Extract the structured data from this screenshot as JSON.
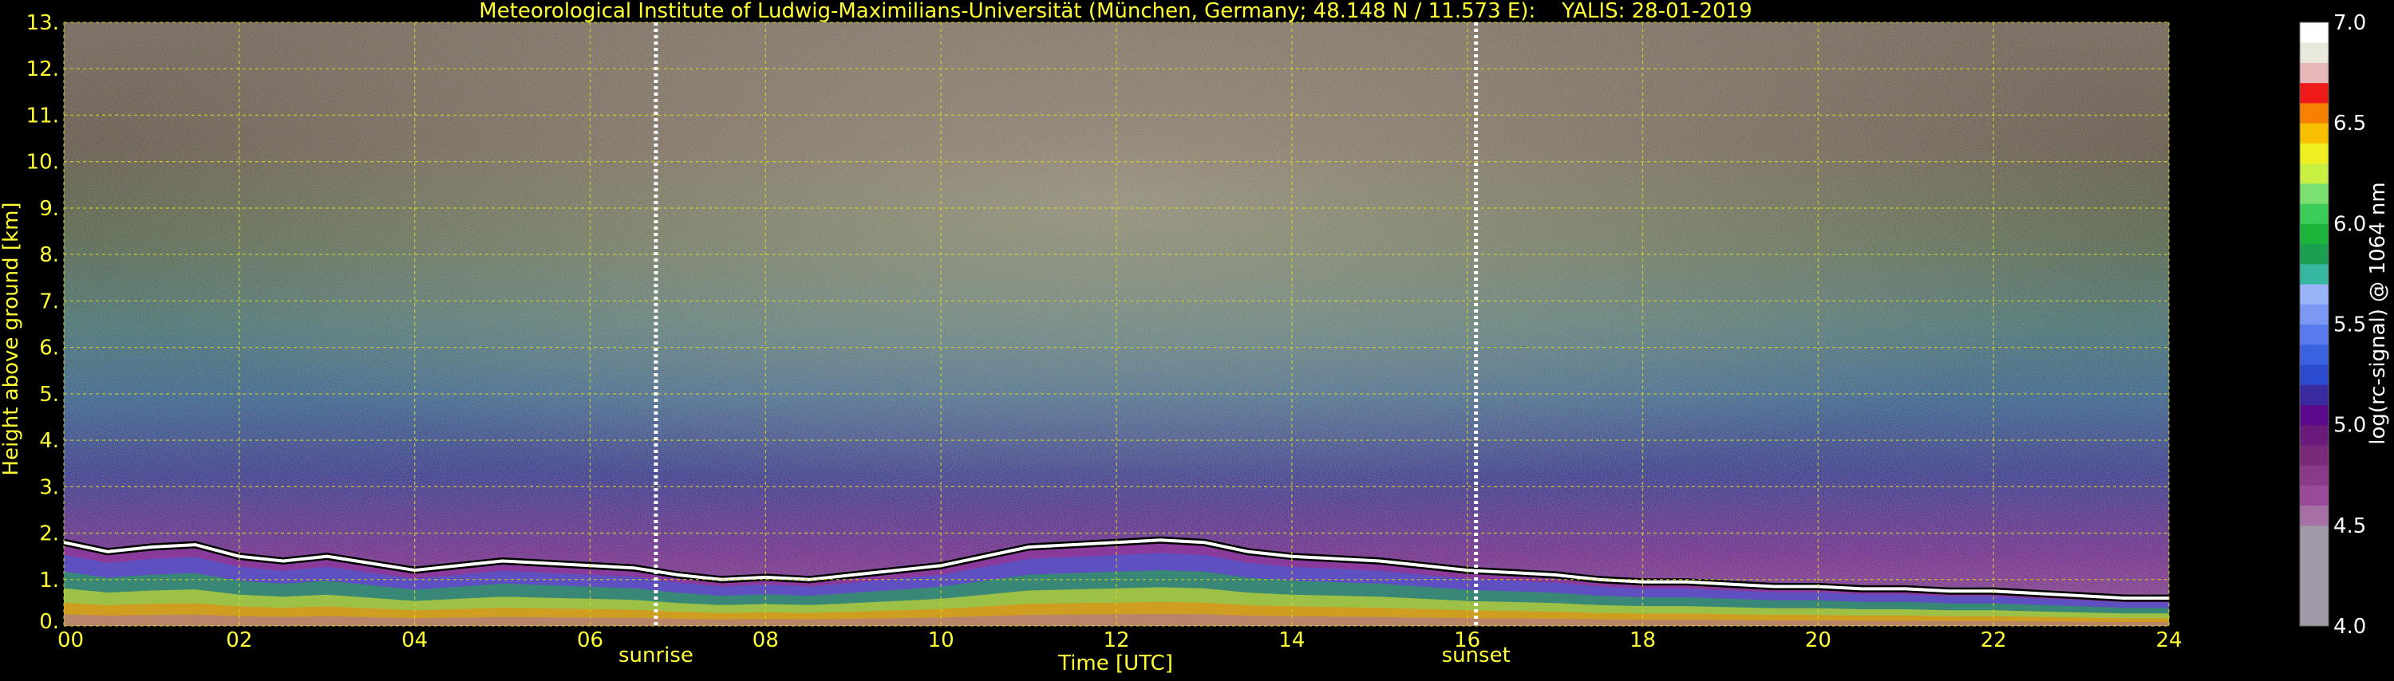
{
  "chart_data": {
    "type": "heatmap",
    "title": "Meteorological Institute of Ludwig-Maximilians-Universität (München, Germany; 48.148 N / 11.573 E):    YALIS: 28-01-2019",
    "xlabel": "Time [UTC]",
    "ylabel": "Height above ground [km]",
    "xlim": [
      0,
      24
    ],
    "ylim": [
      0,
      13
    ],
    "x_ticks": [
      0,
      2,
      4,
      6,
      8,
      10,
      12,
      14,
      16,
      18,
      20,
      22,
      24
    ],
    "x_tick_labels": [
      "00",
      "02",
      "04",
      "06",
      "08",
      "10",
      "12",
      "14",
      "16",
      "18",
      "20",
      "22",
      "24"
    ],
    "y_ticks": [
      0,
      1,
      2,
      3,
      4,
      5,
      6,
      7,
      8,
      9,
      10,
      11,
      12,
      13
    ],
    "y_tick_labels": [
      "0.",
      "1.",
      "2.",
      "3.",
      "4.",
      "5.",
      "6.",
      "7.",
      "8.",
      "9.",
      "10.",
      "11.",
      "12.",
      "13."
    ],
    "grid": true,
    "colorbar": {
      "label": "log(rc-signal) @ 1064 nm",
      "range": [
        4.0,
        7.0
      ],
      "ticks": [
        4.0,
        4.5,
        5.0,
        5.5,
        6.0,
        6.5,
        7.0
      ],
      "tick_labels": [
        "4.0",
        "4.5",
        "5.0",
        "5.5",
        "6.0",
        "6.5",
        "7.0"
      ],
      "levels": [
        {
          "from": 4.0,
          "to": 4.5,
          "color": "#a09aa8"
        },
        {
          "from": 4.5,
          "to": 4.6,
          "color": "#a571a5"
        },
        {
          "from": 4.6,
          "to": 4.7,
          "color": "#9a4a9a"
        },
        {
          "from": 4.7,
          "to": 4.8,
          "color": "#8b3a8b"
        },
        {
          "from": 4.8,
          "to": 4.9,
          "color": "#7a2a7a"
        },
        {
          "from": 4.9,
          "to": 5.0,
          "color": "#6a1a7a"
        },
        {
          "from": 5.0,
          "to": 5.1,
          "color": "#5a0a8a"
        },
        {
          "from": 5.1,
          "to": 5.2,
          "color": "#3a2aa0"
        },
        {
          "from": 5.2,
          "to": 5.3,
          "color": "#2a4ad0"
        },
        {
          "from": 5.3,
          "to": 5.4,
          "color": "#3a62e0"
        },
        {
          "from": 5.4,
          "to": 5.5,
          "color": "#5a7af0"
        },
        {
          "from": 5.5,
          "to": 5.6,
          "color": "#7a98f4"
        },
        {
          "from": 5.6,
          "to": 5.7,
          "color": "#9ab4f8"
        },
        {
          "from": 5.7,
          "to": 5.8,
          "color": "#36b8a0"
        },
        {
          "from": 5.8,
          "to": 5.9,
          "color": "#1aa050"
        },
        {
          "from": 5.9,
          "to": 6.0,
          "color": "#1cb43a"
        },
        {
          "from": 6.0,
          "to": 6.1,
          "color": "#3ccc5a"
        },
        {
          "from": 6.1,
          "to": 6.2,
          "color": "#7ae070"
        },
        {
          "from": 6.2,
          "to": 6.3,
          "color": "#c8f040"
        },
        {
          "from": 6.3,
          "to": 6.4,
          "color": "#f0f020"
        },
        {
          "from": 6.4,
          "to": 6.5,
          "color": "#f8c000"
        },
        {
          "from": 6.5,
          "to": 6.6,
          "color": "#f88000"
        },
        {
          "from": 6.6,
          "to": 6.7,
          "color": "#ee1a1a"
        },
        {
          "from": 6.7,
          "to": 6.8,
          "color": "#e8b8b8"
        },
        {
          "from": 6.8,
          "to": 6.9,
          "color": "#e8e8dc"
        },
        {
          "from": 6.9,
          "to": 7.0,
          "color": "#ffffff"
        }
      ]
    },
    "annotations": [
      {
        "label": "sunrise",
        "x": 6.75
      },
      {
        "label": "sunset",
        "x": 16.1
      }
    ],
    "cloud_top_line": [
      [
        0,
        1.8
      ],
      [
        0.5,
        1.6
      ],
      [
        1,
        1.7
      ],
      [
        1.5,
        1.75
      ],
      [
        2,
        1.5
      ],
      [
        2.5,
        1.4
      ],
      [
        3,
        1.5
      ],
      [
        3.5,
        1.35
      ],
      [
        4,
        1.2
      ],
      [
        4.5,
        1.3
      ],
      [
        5,
        1.4
      ],
      [
        5.5,
        1.35
      ],
      [
        6,
        1.3
      ],
      [
        6.5,
        1.25
      ],
      [
        7,
        1.1
      ],
      [
        7.5,
        1.0
      ],
      [
        8,
        1.05
      ],
      [
        8.5,
        1.0
      ],
      [
        9,
        1.1
      ],
      [
        9.5,
        1.2
      ],
      [
        10,
        1.3
      ],
      [
        10.5,
        1.5
      ],
      [
        11,
        1.7
      ],
      [
        11.5,
        1.75
      ],
      [
        12,
        1.8
      ],
      [
        12.5,
        1.85
      ],
      [
        13,
        1.8
      ],
      [
        13.5,
        1.6
      ],
      [
        14,
        1.5
      ],
      [
        14.5,
        1.45
      ],
      [
        15,
        1.4
      ],
      [
        15.5,
        1.3
      ],
      [
        16,
        1.2
      ],
      [
        16.5,
        1.15
      ],
      [
        17,
        1.1
      ],
      [
        17.5,
        1.0
      ],
      [
        18,
        0.95
      ],
      [
        18.5,
        0.95
      ],
      [
        19,
        0.9
      ],
      [
        19.5,
        0.85
      ],
      [
        20,
        0.85
      ],
      [
        20.5,
        0.8
      ],
      [
        21,
        0.8
      ],
      [
        21.5,
        0.75
      ],
      [
        22,
        0.75
      ],
      [
        22.5,
        0.7
      ],
      [
        23,
        0.65
      ],
      [
        23.5,
        0.6
      ],
      [
        24,
        0.6
      ]
    ]
  }
}
